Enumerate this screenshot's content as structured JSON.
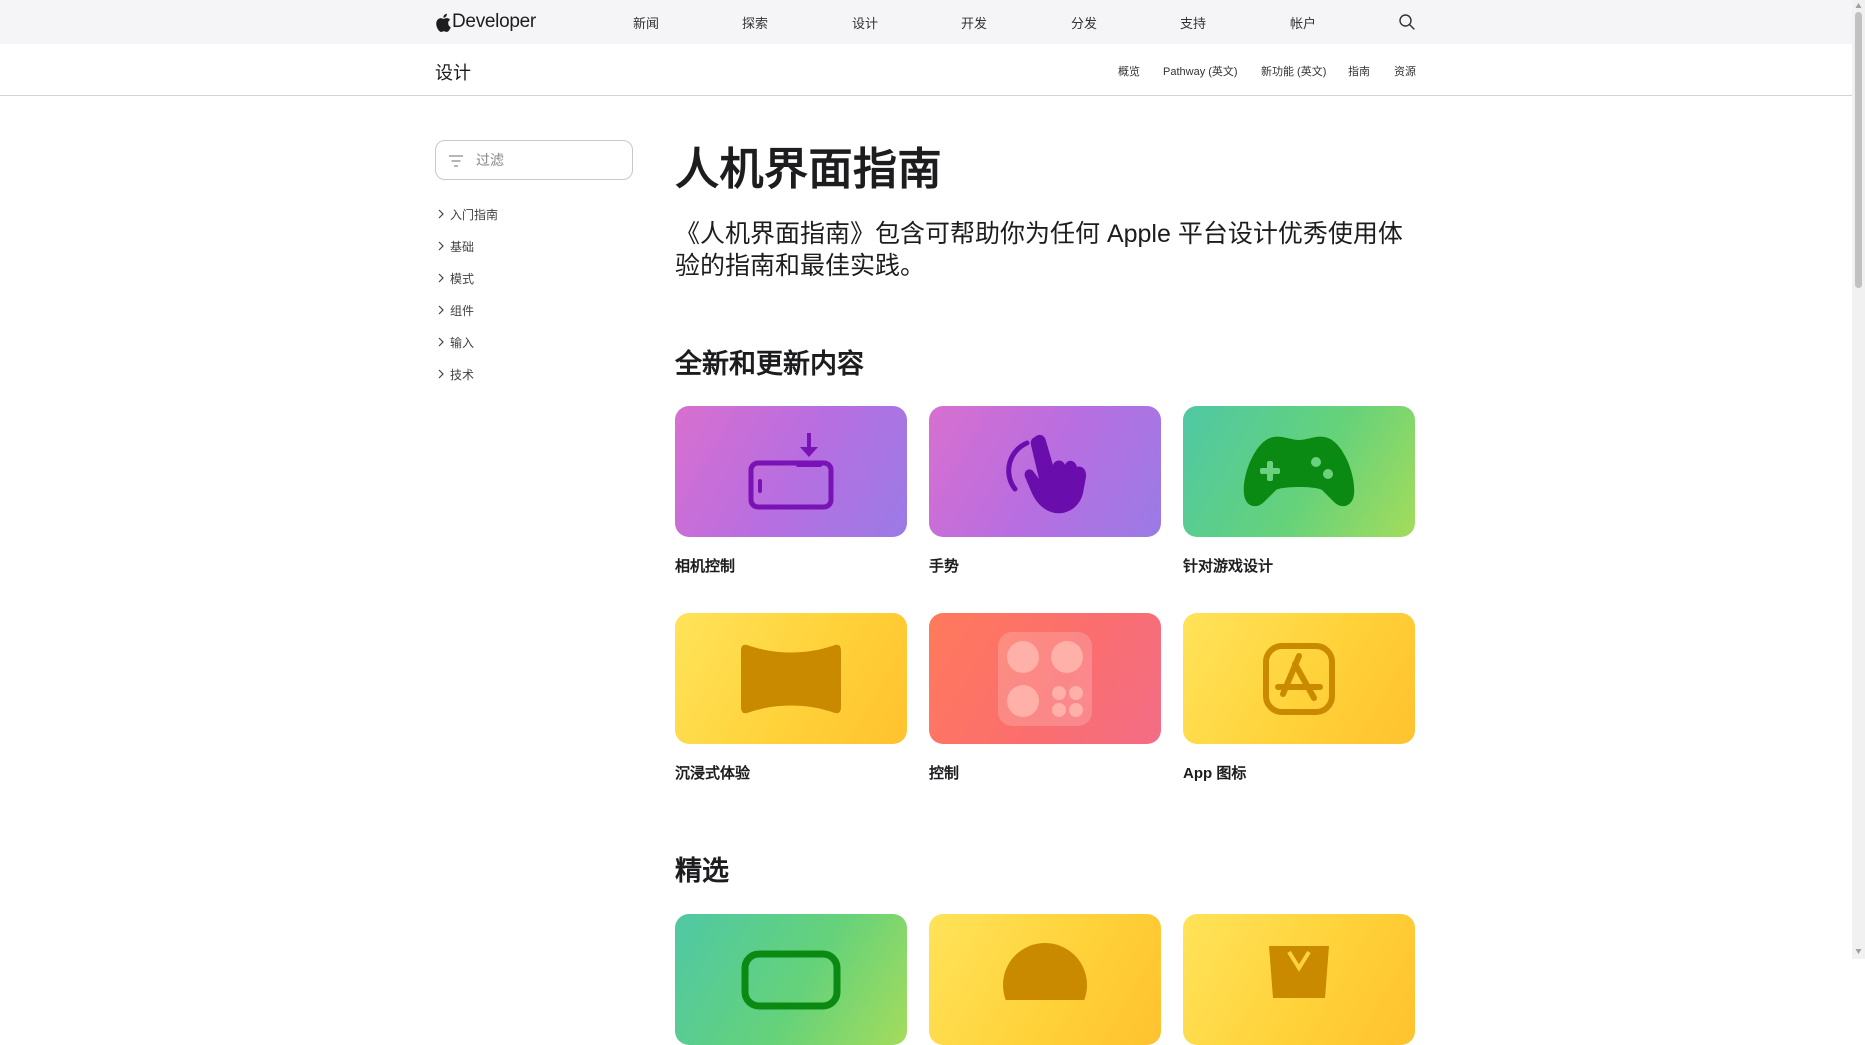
{
  "globalnav": {
    "logo_text": "Developer",
    "items": [
      "新闻",
      "探索",
      "设计",
      "开发",
      "分发",
      "支持",
      "帐户"
    ]
  },
  "localnav": {
    "title": "设计",
    "links": [
      "概览",
      "Pathway (英文)",
      "新功能 (英文)",
      "指南",
      "资源"
    ]
  },
  "sidebar": {
    "filter_placeholder": "过滤",
    "items": [
      "入门指南",
      "基础",
      "模式",
      "组件",
      "输入",
      "技术"
    ]
  },
  "main": {
    "title": "人机界面指南",
    "intro": "《人机界面指南》包含可帮助你为任何 Apple 平台设计优秀使用体验的指南和最佳实践。",
    "sections": [
      {
        "heading": "全新和更新内容",
        "cards": [
          {
            "label": "相机控制",
            "icon": "camera-control-icon",
            "accent": "#7a13b5"
          },
          {
            "label": "手势",
            "icon": "gesture-hand-icon",
            "accent": "#6a0dad"
          },
          {
            "label": "针对游戏设计",
            "icon": "game-controller-icon",
            "accent": "#0a8a12"
          },
          {
            "label": "沉浸式体验",
            "icon": "immersive-icon",
            "accent": "#c98a00"
          },
          {
            "label": "控制",
            "icon": "controls-grid-icon",
            "accent": "#ffb0a8"
          },
          {
            "label": "App 图标",
            "icon": "app-store-icon",
            "accent": "#c98a00"
          }
        ]
      },
      {
        "heading": "精选",
        "cards": [
          {
            "label": "",
            "icon": "featured-green-icon",
            "accent": "#0a8a12"
          },
          {
            "label": "",
            "icon": "featured-yellow-icon",
            "accent": "#c98a00"
          },
          {
            "label": "",
            "icon": "featured-yellow2-icon",
            "accent": "#c98a00"
          }
        ]
      }
    ]
  }
}
